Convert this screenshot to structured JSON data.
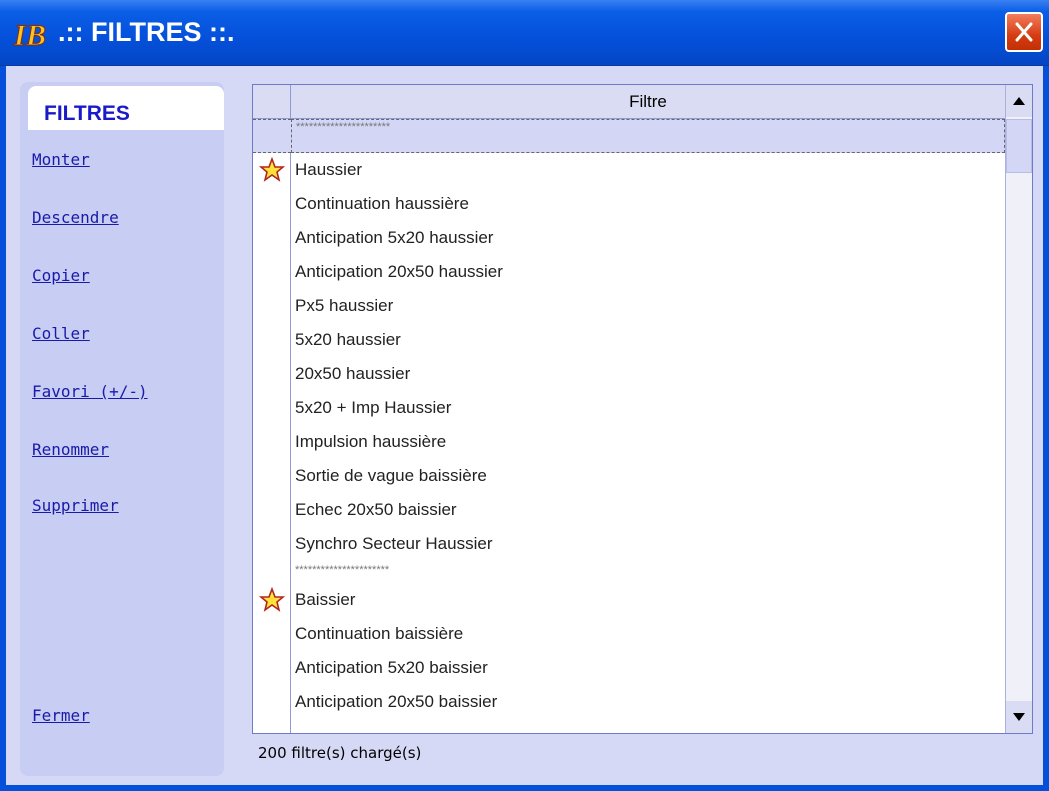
{
  "window": {
    "logo_text": "IB",
    "title": ".:: FILTRES ::.",
    "close_icon": "close-x-icon",
    "colors": {
      "titlebar": "#0550da",
      "close": "#d63c12",
      "panel": "#c8cdf3",
      "link": "#1a1aa8"
    }
  },
  "nav": {
    "title": "FILTRES",
    "links": {
      "monter": "Monter",
      "descendre": "Descendre",
      "copier": "Copier",
      "coller": "Coller",
      "favori": "Favori (+/-)",
      "renommer": "Renommer",
      "supprimer": "Supprimer",
      "fermer": "Fermer"
    }
  },
  "grid": {
    "column_header": "Filtre",
    "rows": [
      {
        "label": "**********************",
        "separator": true,
        "selected": true,
        "favorite": false
      },
      {
        "label": "Haussier",
        "favorite": true
      },
      {
        "label": "Continuation haussière"
      },
      {
        "label": "Anticipation 5x20 haussier"
      },
      {
        "label": "Anticipation 20x50 haussier"
      },
      {
        "label": "Px5 haussier"
      },
      {
        "label": "5x20 haussier"
      },
      {
        "label": "20x50 haussier"
      },
      {
        "label": "5x20 + Imp Haussier"
      },
      {
        "label": "Impulsion haussière"
      },
      {
        "label": "Sortie de vague baissière"
      },
      {
        "label": "Echec 20x50 baissier"
      },
      {
        "label": "Synchro Secteur Haussier"
      },
      {
        "label": "**********************",
        "separator": true
      },
      {
        "label": "Baissier",
        "favorite": true
      },
      {
        "label": "Continuation baissière"
      },
      {
        "label": "Anticipation 5x20 baissier"
      },
      {
        "label": "Anticipation 20x50 baissier"
      }
    ]
  },
  "status": {
    "text": "200 filtre(s) chargé(s)"
  }
}
